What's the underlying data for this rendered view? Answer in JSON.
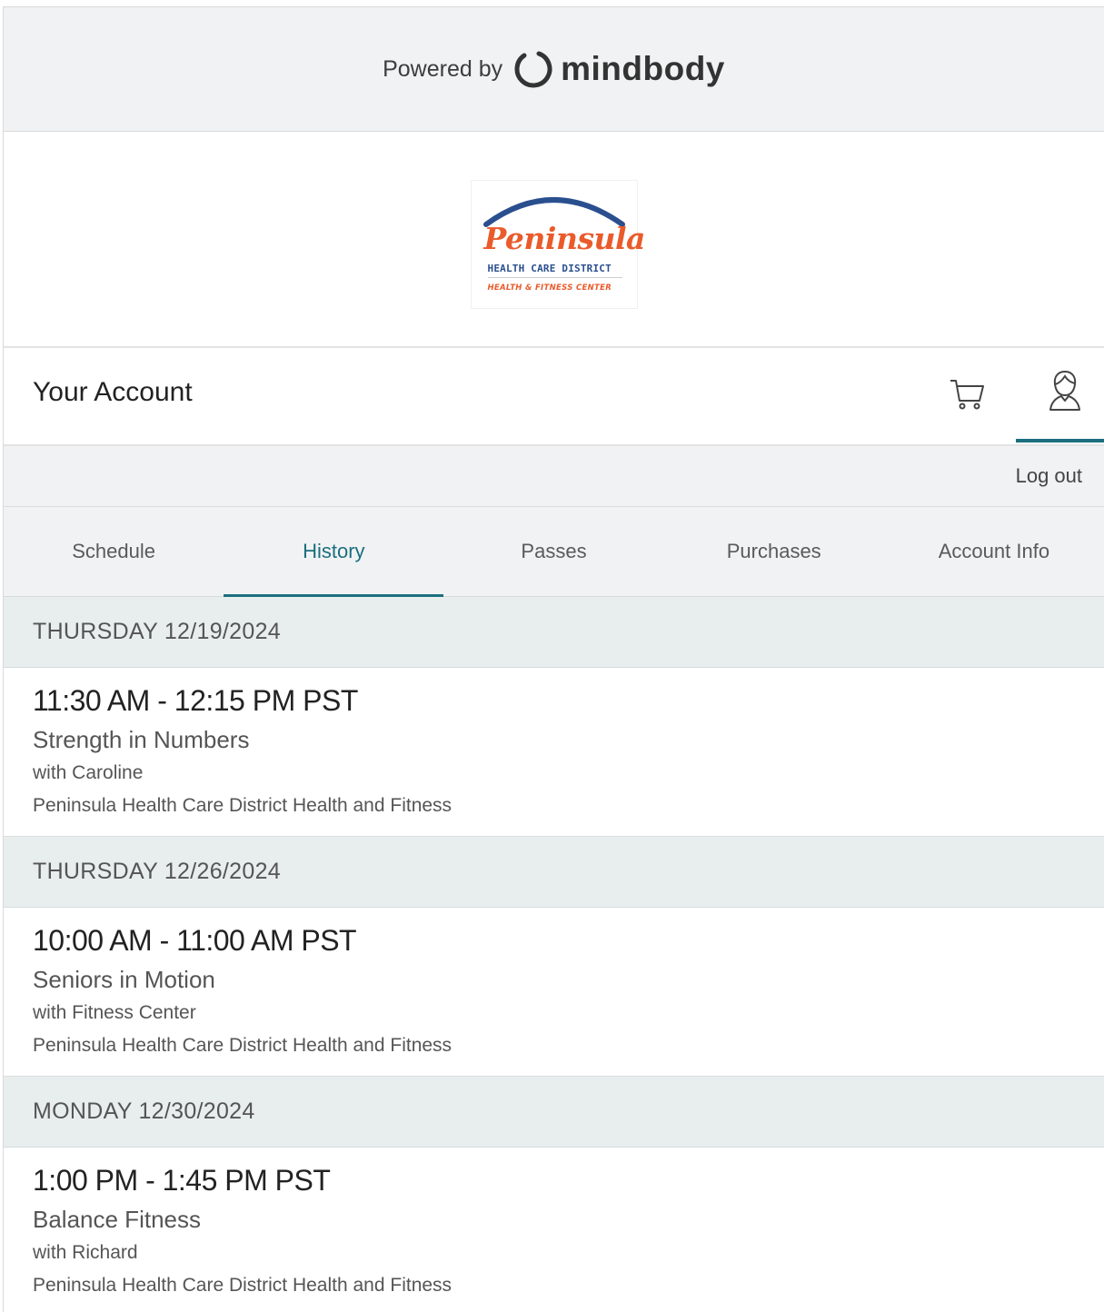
{
  "powered": {
    "prefix": "Powered by",
    "brand": "mindbody"
  },
  "logo": {
    "script": "Peninsula",
    "line1": "HEALTH CARE DISTRICT",
    "line2": "HEALTH & FITNESS CENTER",
    "colors": {
      "orange": "#ea5b2b",
      "navy": "#2a4f8f"
    }
  },
  "header": {
    "title": "Your Account",
    "icons": [
      "cart-icon",
      "user-icon"
    ]
  },
  "logout": "Log out",
  "tabs": [
    {
      "label": "Schedule",
      "active": false
    },
    {
      "label": "History",
      "active": true
    },
    {
      "label": "Passes",
      "active": false
    },
    {
      "label": "Purchases",
      "active": false
    },
    {
      "label": "Account Info",
      "active": false
    }
  ],
  "accent": "#1b6f7e",
  "history": [
    {
      "day": "THURSDAY 12/19/2024",
      "time": "11:30 AM - 12:15 PM PST",
      "class": "Strength in Numbers",
      "instructor": "with Caroline",
      "location": "Peninsula Health Care District Health and Fitness"
    },
    {
      "day": "THURSDAY 12/26/2024",
      "time": "10:00 AM - 11:00 AM PST",
      "class": "Seniors in Motion",
      "instructor": "with Fitness Center",
      "location": "Peninsula Health Care District Health and Fitness"
    },
    {
      "day": "MONDAY 12/30/2024",
      "time": "1:00 PM - 1:45 PM PST",
      "class": "Balance Fitness",
      "instructor": "with Richard",
      "location": "Peninsula Health Care District Health and Fitness"
    }
  ]
}
